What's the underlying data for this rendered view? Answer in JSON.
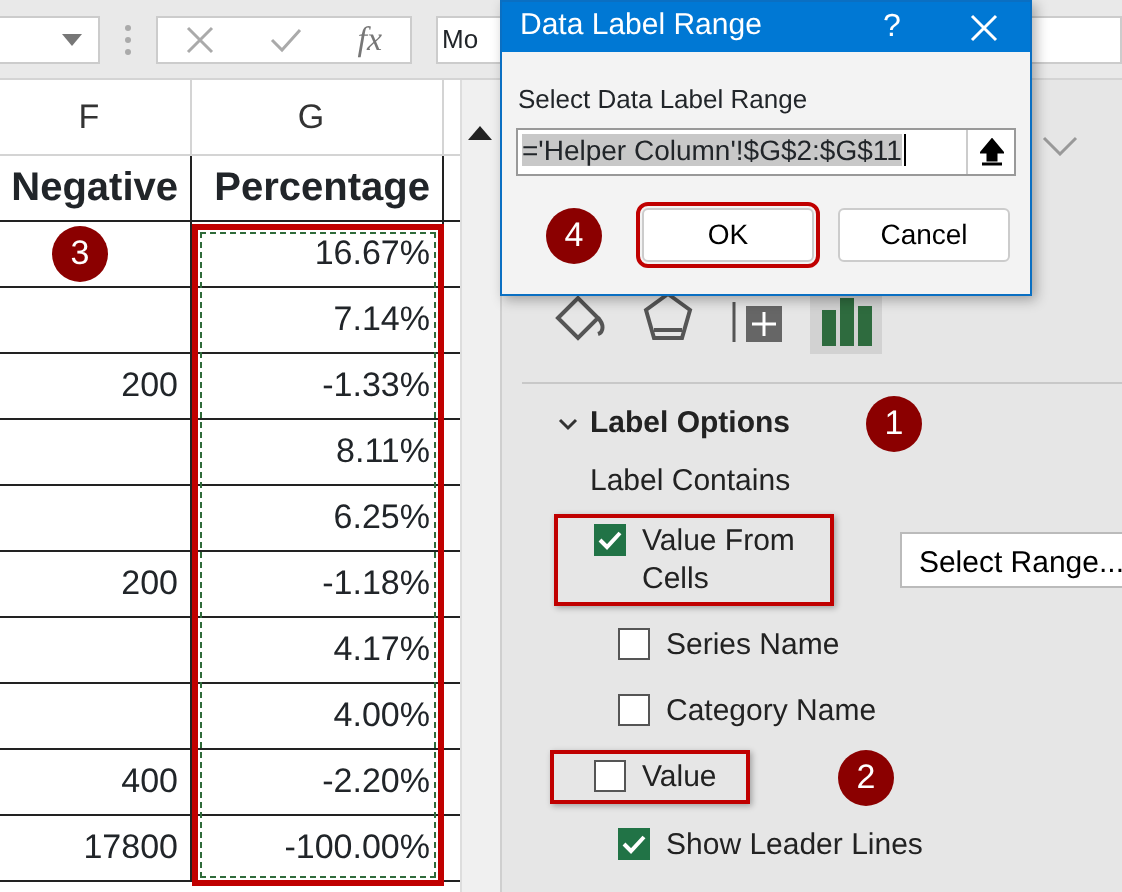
{
  "formula_bar": {
    "function_label": "fx",
    "cut_text": "Mo"
  },
  "columns": [
    {
      "letter": "F",
      "header": "Negative"
    },
    {
      "letter": "G",
      "header": "Percentage",
      "highlighted": true
    }
  ],
  "rows": [
    {
      "negative": "",
      "percentage": "16.67%",
      "callout": "3"
    },
    {
      "negative": "",
      "percentage": "7.14%"
    },
    {
      "negative": "200",
      "percentage": "-1.33%"
    },
    {
      "negative": "",
      "percentage": "8.11%"
    },
    {
      "negative": "",
      "percentage": "6.25%"
    },
    {
      "negative": "200",
      "percentage": "-1.18%"
    },
    {
      "negative": "",
      "percentage": "4.17%"
    },
    {
      "negative": "",
      "percentage": "4.00%"
    },
    {
      "negative": "400",
      "percentage": "-2.20%"
    },
    {
      "negative": "17800",
      "percentage": "-100.00%"
    }
  ],
  "dialog": {
    "title": "Data Label Range",
    "help": "?",
    "prompt": "Select Data Label Range",
    "value": "='Helper Column'!$G$2:$G$11",
    "callout": "4",
    "buttons": [
      {
        "label": "OK",
        "highlighted": true
      },
      {
        "label": "Cancel",
        "highlighted": false
      }
    ]
  },
  "pane": {
    "icon_tabs": [
      {
        "kind": "fill",
        "selected": false
      },
      {
        "kind": "effects",
        "selected": false
      },
      {
        "kind": "size",
        "selected": false
      },
      {
        "kind": "chart",
        "selected": true
      }
    ],
    "section": {
      "title": "Label Options",
      "expanded": true,
      "callout": "1"
    },
    "subheading": "Label Contains",
    "select_range": "Select Range...",
    "options": [
      {
        "label": "Value From Cells",
        "checked": true,
        "highlighted": true
      },
      {
        "label": "Series Name",
        "checked": false,
        "highlighted": false
      },
      {
        "label": "Category Name",
        "checked": false,
        "highlighted": false
      },
      {
        "label": "Value",
        "checked": false,
        "highlighted": true,
        "callout": "2"
      },
      {
        "label": "Show Leader Lines",
        "checked": true,
        "highlighted": false
      }
    ]
  }
}
